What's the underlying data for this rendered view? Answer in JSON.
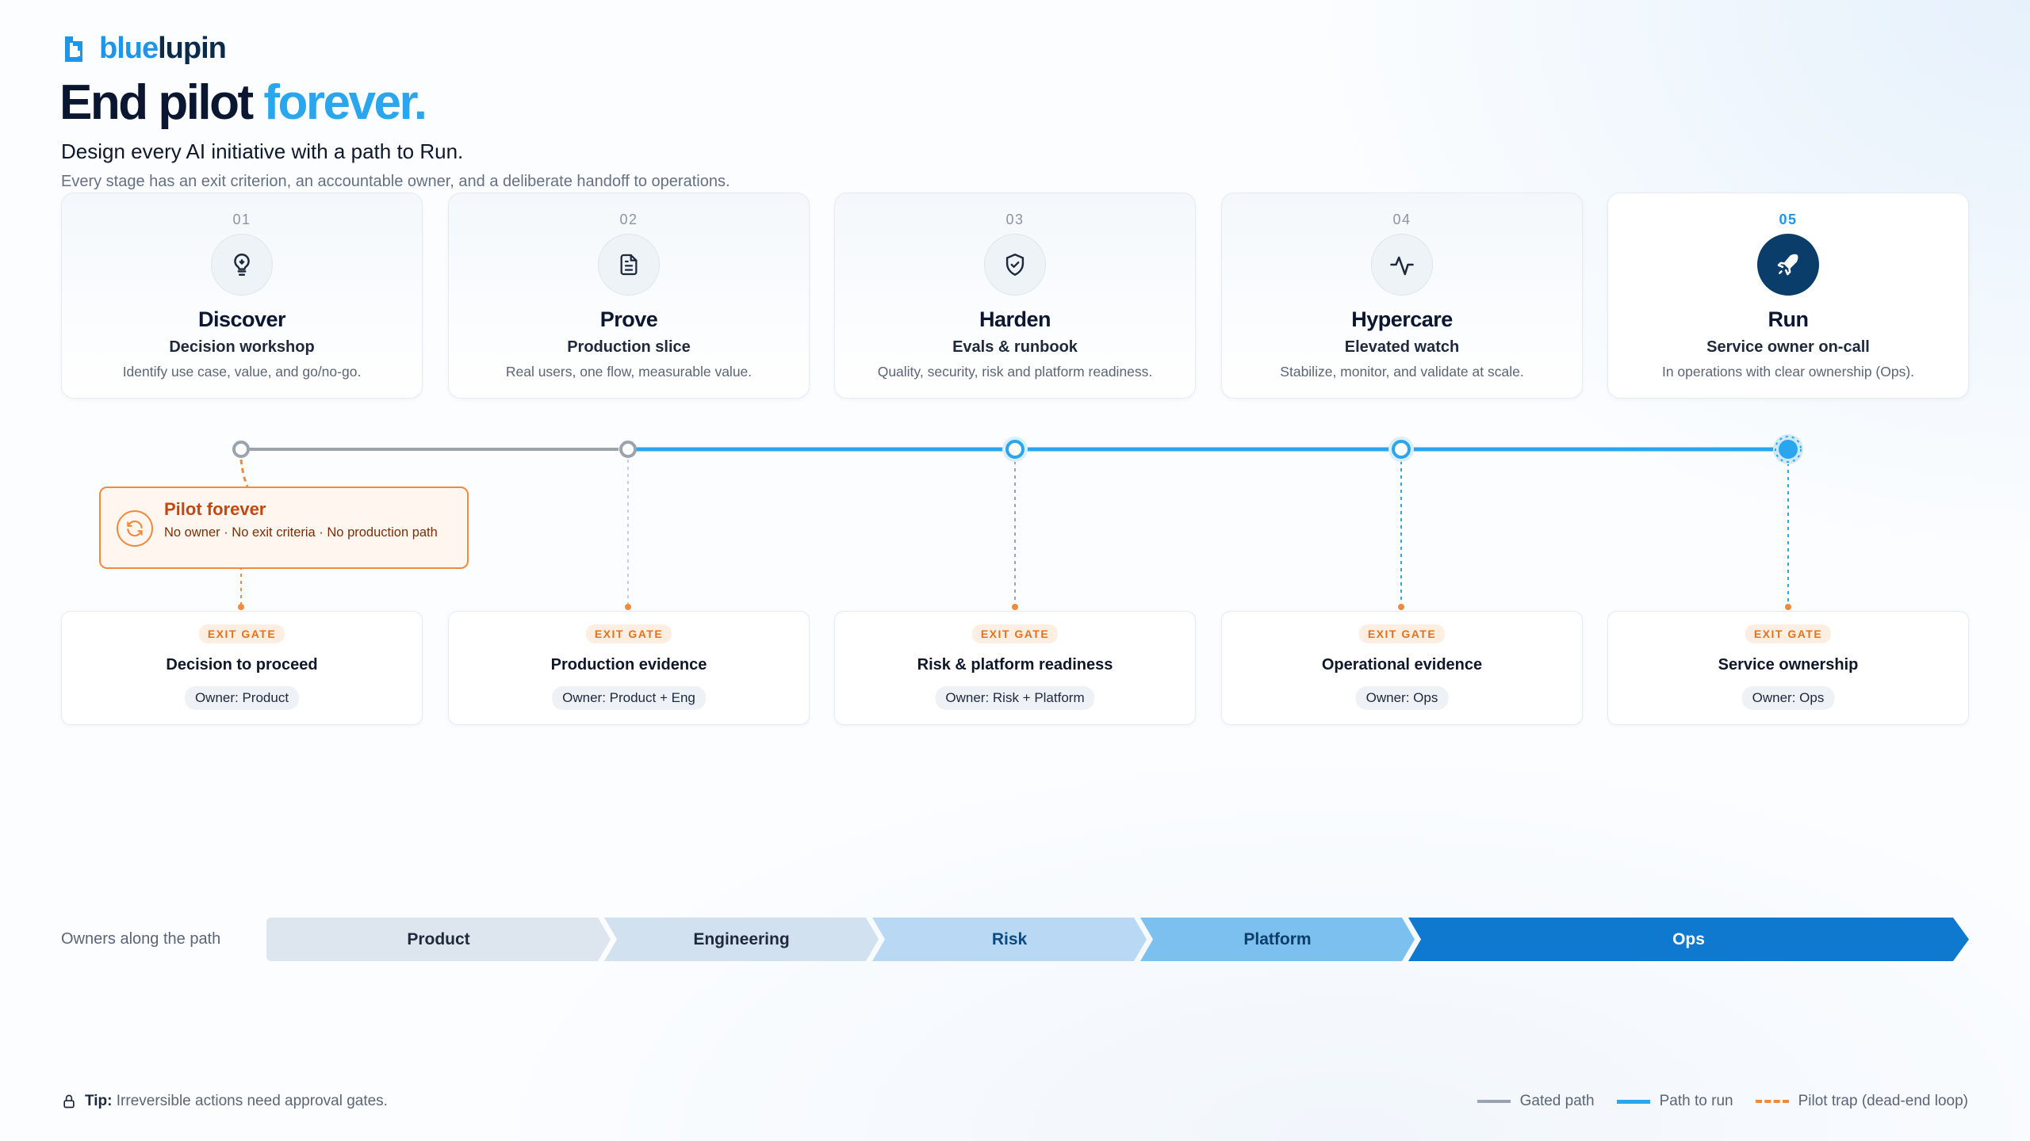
{
  "brand": {
    "logo_part1": "blue",
    "logo_part2": "lupin",
    "logo_color": "#1f95e8"
  },
  "header": {
    "title_main": "End pilot",
    "title_accent": "forever.",
    "subtitle": "Design every AI initiative with a path to Run.",
    "description": "Every stage has an exit criterion, an accountable owner, and a deliberate handoff to operations."
  },
  "stages": [
    {
      "num": "01",
      "name": "Discover",
      "sub": "Decision workshop",
      "desc": "Identify use case, value, and go/no-go.",
      "icon": "lightbulb-icon"
    },
    {
      "num": "02",
      "name": "Prove",
      "sub": "Production slice",
      "desc": "Real users, one flow, measurable value.",
      "icon": "document-icon"
    },
    {
      "num": "03",
      "name": "Harden",
      "sub": "Evals & runbook",
      "desc": "Quality, security, risk and platform readiness.",
      "icon": "shield-check-icon"
    },
    {
      "num": "04",
      "name": "Hypercare",
      "sub": "Elevated watch",
      "desc": "Stabilize, monitor, and validate at scale.",
      "icon": "activity-icon"
    },
    {
      "num": "05",
      "name": "Run",
      "sub": "Service owner on-call",
      "desc": "In operations with clear ownership (Ops).",
      "icon": "rocket-icon"
    }
  ],
  "pilot_trap": {
    "title": "Pilot forever",
    "desc": "No owner · No exit criteria · No production path"
  },
  "gates": [
    {
      "badge": "EXIT GATE",
      "title": "Decision to proceed",
      "owner": "Owner: Product"
    },
    {
      "badge": "EXIT GATE",
      "title": "Production evidence",
      "owner": "Owner: Product + Eng"
    },
    {
      "badge": "EXIT GATE",
      "title": "Risk & platform readiness",
      "owner": "Owner: Risk + Platform"
    },
    {
      "badge": "EXIT GATE",
      "title": "Operational evidence",
      "owner": "Owner: Ops"
    },
    {
      "badge": "EXIT GATE",
      "title": "Service ownership",
      "owner": "Owner: Ops"
    }
  ],
  "owners": {
    "label": "Owners along the path",
    "segments": [
      {
        "name": "Product",
        "bg": "#dde5ee",
        "fg": "#1e293b"
      },
      {
        "name": "Engineering",
        "bg": "#d2e1f0",
        "fg": "#1e293b"
      },
      {
        "name": "Risk",
        "bg": "#b8d8f3",
        "fg": "#0b4a80"
      },
      {
        "name": "Platform",
        "bg": "#7cc0ef",
        "fg": "#0b3d6b"
      },
      {
        "name": "Ops",
        "bg": "#0f78cf",
        "fg": "#ffffff"
      }
    ]
  },
  "footer": {
    "tip_label": "Tip:",
    "tip_text": "Irreversible actions need approval gates.",
    "legend": [
      {
        "label": "Gated path",
        "color": "#9aa3ae",
        "style": "solid"
      },
      {
        "label": "Path to run",
        "color": "#2aa6ee",
        "style": "solid"
      },
      {
        "label": "Pilot trap (dead-end loop)",
        "color": "#f08a3c",
        "style": "dashed"
      }
    ]
  },
  "colors": {
    "accent": "#2aa6ee",
    "gray_path": "#9aa3ae",
    "trap": "#f08a3c",
    "dark_navy": "#0b3d6b"
  }
}
